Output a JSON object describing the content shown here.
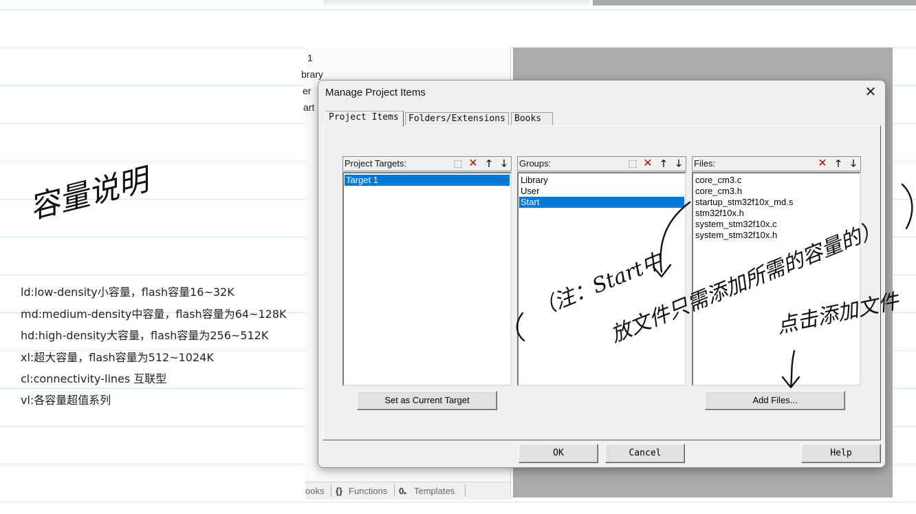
{
  "notes": {
    "handwritten_title": "容量说明",
    "lines": [
      "ld:low-density小容量，flash容量16~32K",
      "md:medium-density中容量，flash容量为64~128K",
      "hd:high-density大容量，flash容量为256~512K",
      "xl:超大容量，flash容量为512~1024K",
      "cl:connectivity-lines 互联型",
      "vl:各容量超值系列"
    ]
  },
  "ide_background": {
    "tree_fragments": [
      "1",
      "brary",
      "er",
      "art"
    ],
    "bottom_tabs": [
      "ooks",
      "Functions",
      "Templates"
    ]
  },
  "dialog": {
    "title": "Manage Project Items",
    "close_label": "✕",
    "tabs": [
      {
        "label": "Project Items",
        "active": true
      },
      {
        "label": "Folders/Extensions",
        "active": false
      },
      {
        "label": "Books",
        "active": false
      }
    ],
    "targets": {
      "header": "Project Targets:",
      "items": [
        "Target 1"
      ],
      "selected_index": 0,
      "button": "Set as Current Target",
      "icons": [
        "new-icon",
        "delete-icon",
        "move-up-icon",
        "move-down-icon"
      ]
    },
    "groups": {
      "header": "Groups:",
      "items": [
        "Library",
        "User",
        "Start"
      ],
      "selected_index": 2,
      "icons": [
        "new-icon",
        "delete-icon",
        "move-up-icon",
        "move-down-icon"
      ]
    },
    "files": {
      "header": "Files:",
      "items": [
        "core_cm3.c",
        "core_cm3.h",
        "startup_stm32f10x_md.s",
        "stm32f10x.h",
        "system_stm32f10x.c",
        "system_stm32f10x.h"
      ],
      "button": "Add Files...",
      "icons": [
        "delete-icon",
        "move-up-icon",
        "move-down-icon"
      ]
    },
    "footer": {
      "ok": "OK",
      "cancel": "Cancel",
      "help": "Help"
    }
  },
  "annotations": {
    "note_line1": "（注：Start中",
    "note_line2": "放文件只需添加所需的容量的）",
    "add_hint": "点击添加文件"
  },
  "colors": {
    "selection": "#0078d7",
    "delete_icon": "#d40000",
    "notebook_rule": "#d6e8f1"
  }
}
